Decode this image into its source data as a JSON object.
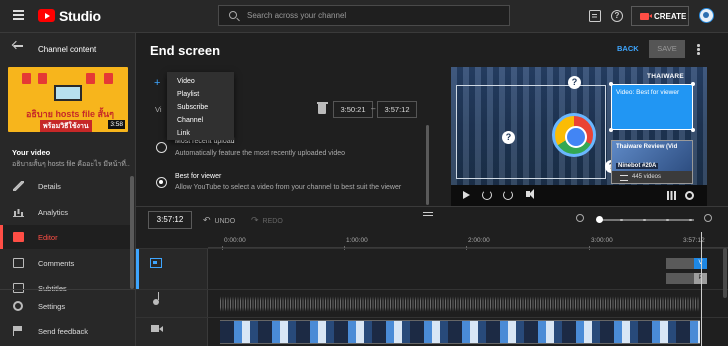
{
  "app": {
    "logo_text": "Studio"
  },
  "search": {
    "placeholder": "Search across your channel"
  },
  "header": {
    "create_label": "CREATE"
  },
  "sidebar": {
    "back_label": "Channel content",
    "thumbnail": {
      "line1": "อธิบาย hosts file สั้นๆ",
      "line2": "พร้อมวิธีใช้งาน",
      "duration": "3:58"
    },
    "your_video_label": "Your video",
    "video_title": "อธิบายสั้นๆ hosts file คืออะไร มีหน้าที่...",
    "items": [
      {
        "label": "Details",
        "icon": "pencil-icon"
      },
      {
        "label": "Analytics",
        "icon": "analytics-icon"
      },
      {
        "label": "Editor",
        "icon": "editor-icon",
        "active": true
      },
      {
        "label": "Comments",
        "icon": "comments-icon"
      },
      {
        "label": "Subtitles",
        "icon": "subtitles-icon"
      }
    ],
    "bottom_items": [
      {
        "label": "Settings",
        "icon": "gear-icon"
      },
      {
        "label": "Send feedback",
        "icon": "feedback-icon"
      }
    ]
  },
  "page": {
    "title": "End screen",
    "back_label": "BACK",
    "save_label": "SAVE"
  },
  "editor": {
    "partial_label": "Vi",
    "start_time": "3:50:21",
    "end_time": "3:57:12",
    "time_separator": "–",
    "add_menu": [
      "Video",
      "Playlist",
      "Subscribe",
      "Channel",
      "Link"
    ],
    "options": [
      {
        "title": "Most recent upload",
        "desc": "Automatically feature the most recently uploaded video",
        "selected": false
      },
      {
        "title": "Best for viewer",
        "desc": "Allow YouTube to select a video from your channel to best suit the viewer",
        "selected": true
      }
    ]
  },
  "preview": {
    "brand": "THAIWARE",
    "video_element_label": "Video: Best for viewer",
    "playlist_title": "Thaiware Review (Vid",
    "playlist_badge": "Ninebot #20A",
    "playlist_count": "445 videos"
  },
  "timeline": {
    "current_time": "3:57:12",
    "undo_label": "UNDO",
    "redo_label": "REDO",
    "ticks": [
      "0:00:00",
      "1:00:00",
      "2:00:00",
      "3:00:00",
      "3:57:12"
    ],
    "chips": [
      "V",
      "P"
    ]
  }
}
